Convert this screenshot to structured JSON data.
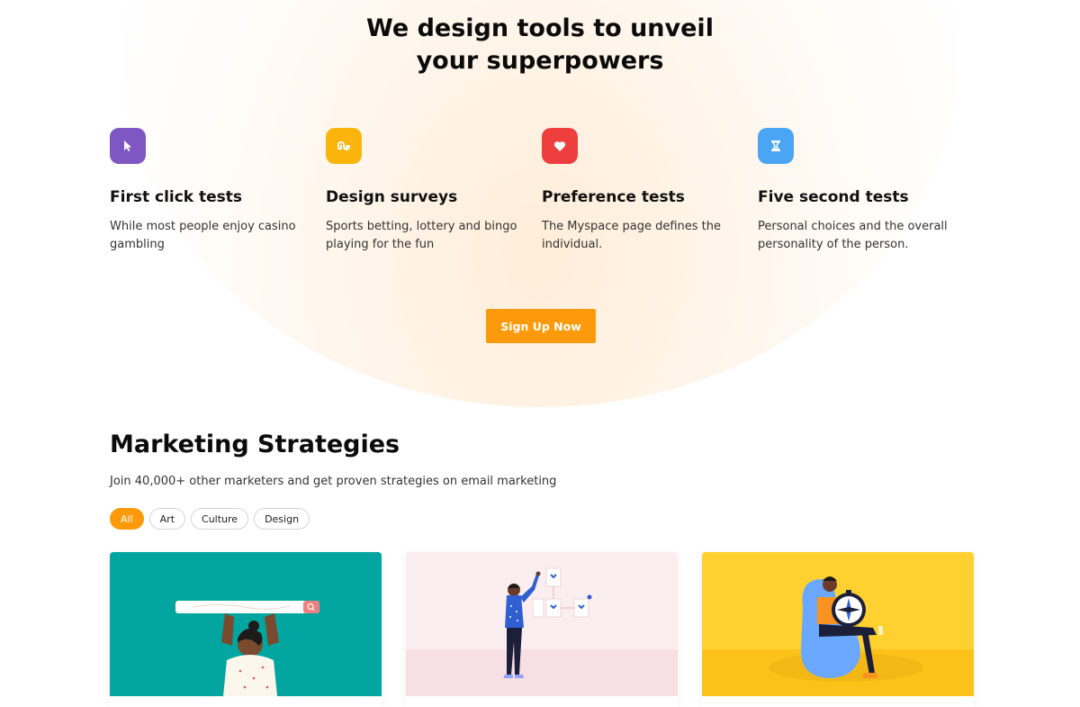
{
  "hero": {
    "title_line1": "We design tools to unveil",
    "title_line2": "your superpowers"
  },
  "features": [
    {
      "icon": "cursor-icon",
      "color": "#7e57c2",
      "title": "First click tests",
      "desc": "While most people enjoy casino gambling"
    },
    {
      "icon": "stumbleupon-icon",
      "color": "#fbb40b",
      "title": "Design surveys",
      "desc": "Sports betting, lottery and bingo playing for the fun"
    },
    {
      "icon": "heart-icon",
      "color": "#ef3e3e",
      "title": "Preference tests",
      "desc": "The Myspace page defines the individual."
    },
    {
      "icon": "hourglass-icon",
      "color": "#4aa6f4",
      "title": "Five second tests",
      "desc": "Personal choices and the overall personality of the person."
    }
  ],
  "cta": {
    "label": "Sign Up Now",
    "color": "#fd9a0b"
  },
  "marketing": {
    "title": "Marketing Strategies",
    "subtitle": "Join 40,000+ other marketers and get proven strategies on email marketing",
    "filters": [
      "All",
      "Art",
      "Culture",
      "Design"
    ],
    "active_filter": "All"
  },
  "cards": [
    {
      "image": "person-holding-search-bar-illustration",
      "bg": "#02a59f"
    },
    {
      "image": "person-arranging-diagram-illustration",
      "bg": "#fbeef0"
    },
    {
      "image": "person-with-compass-illustration",
      "bg": "#fed130"
    }
  ]
}
